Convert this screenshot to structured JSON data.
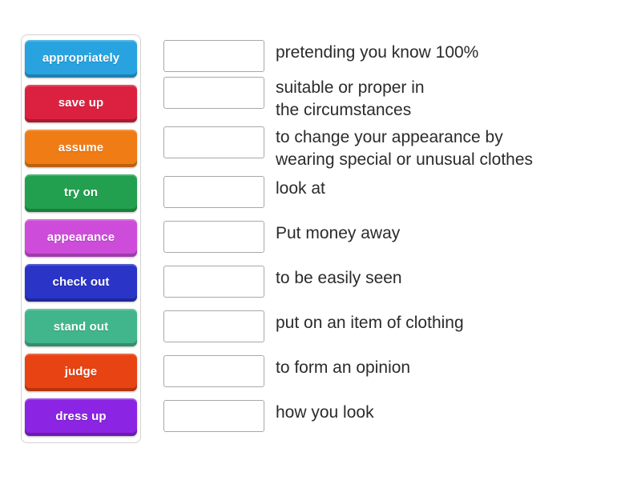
{
  "activity": {
    "type": "match-up",
    "tiles_panel_label": "word tiles",
    "answers_panel_label": "definitions"
  },
  "tiles": [
    {
      "label": "appropriately",
      "color": "#28a3e0"
    },
    {
      "label": "save up",
      "color": "#dc2140"
    },
    {
      "label": "assume",
      "color": "#f07c16"
    },
    {
      "label": "try on",
      "color": "#23a04f"
    },
    {
      "label": "appearance",
      "color": "#cd4cda"
    },
    {
      "label": "check out",
      "color": "#2a34c6"
    },
    {
      "label": "stand out",
      "color": "#41b68c"
    },
    {
      "label": "judge",
      "color": "#e84313"
    },
    {
      "label": "dress up",
      "color": "#8b24e3"
    }
  ],
  "rows": [
    {
      "definition": "pretending you know 100%"
    },
    {
      "definition": "suitable or proper in\nthe circumstances"
    },
    {
      "definition": "to change your appearance by\nwearing special or unusual clothes"
    },
    {
      "definition": "look at"
    },
    {
      "definition": "Put money away"
    },
    {
      "definition": "to be easily seen"
    },
    {
      "definition": "put on an item of clothing"
    },
    {
      "definition": "to form an opinion"
    },
    {
      "definition": "how you look"
    }
  ],
  "colors": {
    "page_background": "#ffffff",
    "panel_border": "#d2d2d2",
    "dropbox_border": "#a8a8a8",
    "definition_text": "#2b2b2b",
    "tile_text": "#ffffff"
  }
}
